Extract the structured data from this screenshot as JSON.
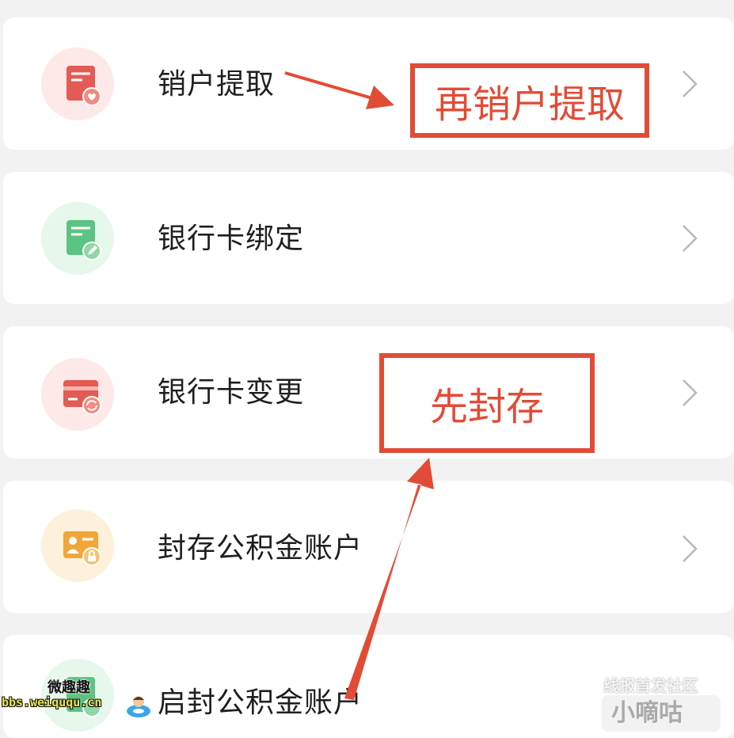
{
  "menu": {
    "items": [
      {
        "label": "销户提取",
        "icon": "card-heart-icon",
        "color": "#e05a52"
      },
      {
        "label": "银行卡绑定",
        "icon": "card-pen-icon",
        "color": "#58c27d"
      },
      {
        "label": "银行卡变更",
        "icon": "card-refresh-icon",
        "color": "#e05a52"
      },
      {
        "label": "封存公积金账户",
        "icon": "person-lock-icon",
        "color": "#f0a738"
      },
      {
        "label": "启封公积金账户",
        "icon": "card-unlock-icon",
        "color": "#58c27d"
      }
    ]
  },
  "annotations": {
    "step_two": "再销户提取",
    "step_one": "先封存",
    "color": "#e24b35"
  },
  "watermarks": {
    "left_title": "微趣趣",
    "left_url": "bbs.weiququ.cn",
    "right_line1": "线报首发社区",
    "right_line2": "小嘀咕"
  }
}
